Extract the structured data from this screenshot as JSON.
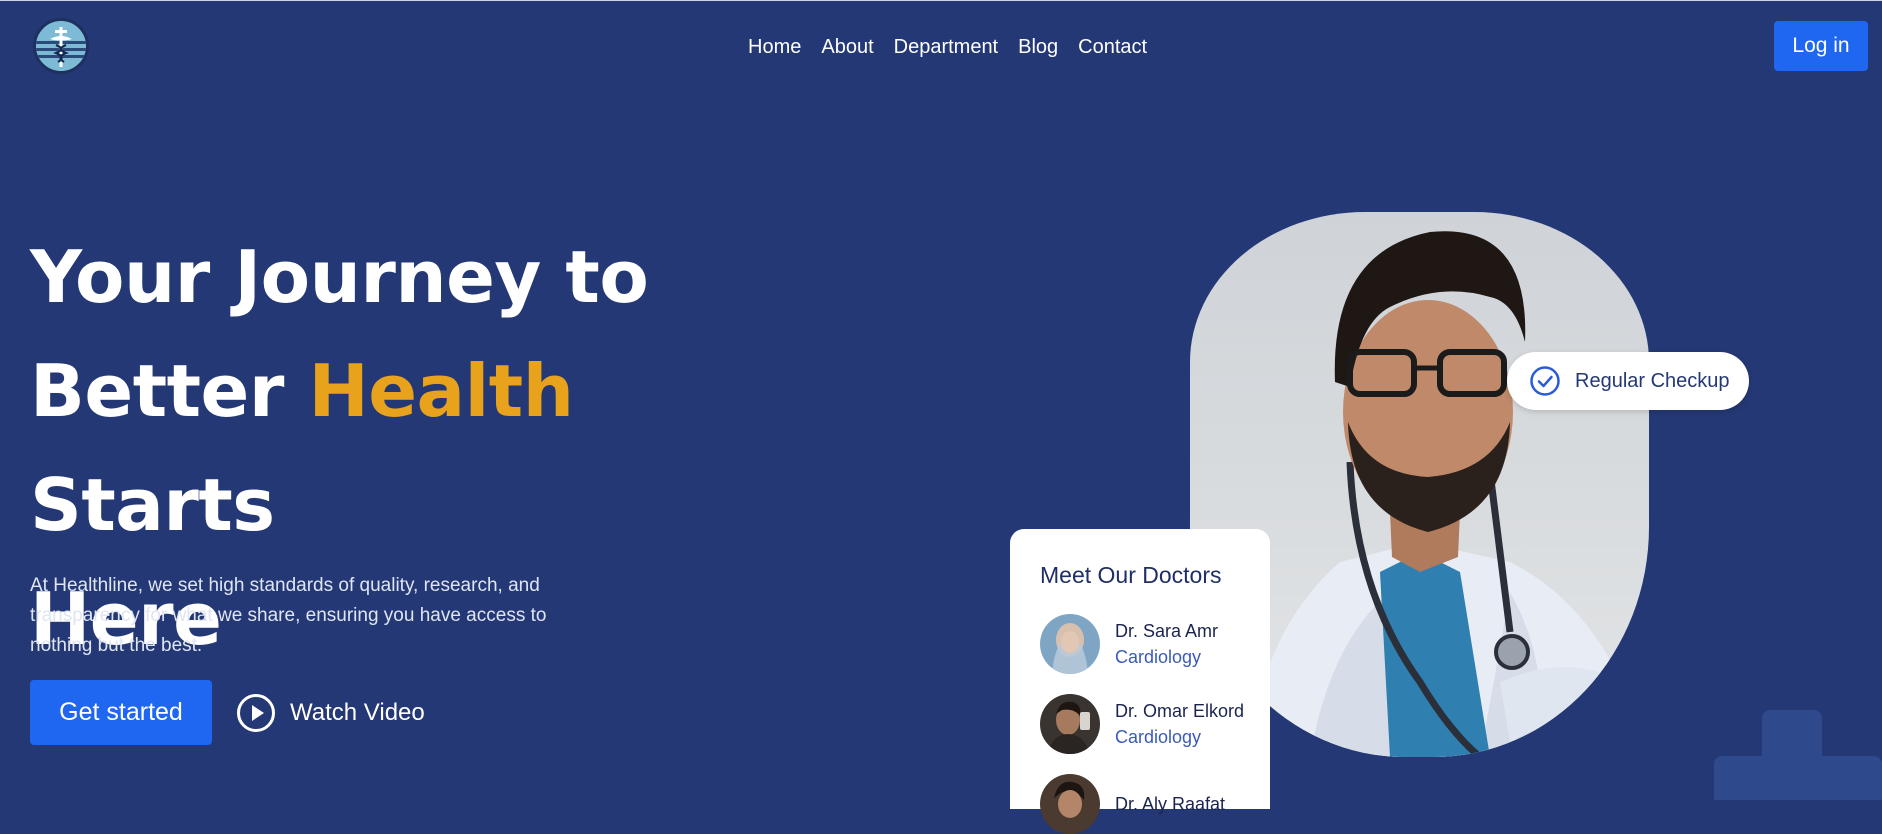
{
  "header": {
    "logo_icon": "caduceus-icon",
    "nav": [
      "Home",
      "About",
      "Department",
      "Blog",
      "Contact"
    ],
    "login_label": "Log in"
  },
  "hero": {
    "title_part1": "Your Journey to",
    "title_part2_before": "Better ",
    "title_accent": "Health",
    "title_part2_after": " Starts",
    "title_part3": "Here",
    "description": "At Healthline, we set high standards of quality, research, and transparency for what we share, ensuring you have access to nothing but the best.",
    "cta_label": "Get started",
    "watch_label": "Watch Video",
    "watch_icon": "play-circle-icon"
  },
  "badge": {
    "icon": "check-circle-icon",
    "label": "Regular Checkup"
  },
  "doctors_card": {
    "title": "Meet Our Doctors",
    "doctors": [
      {
        "name": "Dr. Sara Amr",
        "dept": "Cardiology"
      },
      {
        "name": "Dr. Omar Elkord",
        "dept": "Cardiology"
      },
      {
        "name": "Dr. Aly Raafat",
        "dept": ""
      }
    ]
  },
  "colors": {
    "background": "#243875",
    "accent": "#e8a21c",
    "primary_button": "#1f66f0"
  }
}
